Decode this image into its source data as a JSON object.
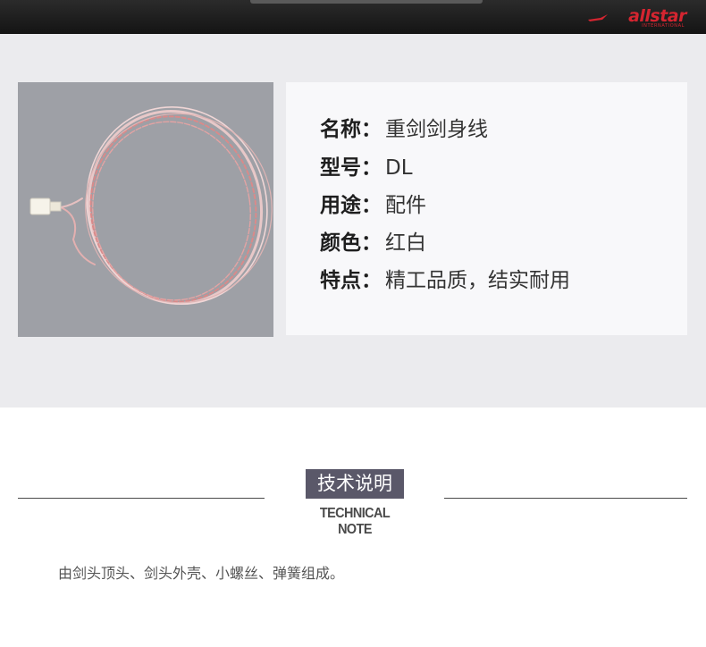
{
  "brand": {
    "name": "allstar",
    "sub": "INTERNATIONAL",
    "color": "#d42530"
  },
  "product_image": {
    "icon": "coiled-body-wire-image"
  },
  "specs": [
    {
      "key": "名称：",
      "value": "重剑剑身线"
    },
    {
      "key": "型号：",
      "value": "DL"
    },
    {
      "key": "用途：",
      "value": "配件"
    },
    {
      "key": "颜色：",
      "value": "红白"
    },
    {
      "key": "特点：",
      "value": "精工品质，结实耐用"
    }
  ],
  "section": {
    "title": "技术说明",
    "subtitle": "TECHNICAL NOTE",
    "description": "由剑头顶头、剑头外壳、小螺丝、弹簧组成。"
  },
  "colors": {
    "topbar": "#1c1c1c",
    "hero_bg": "#ebebee",
    "title_bg": "#5a5869"
  }
}
